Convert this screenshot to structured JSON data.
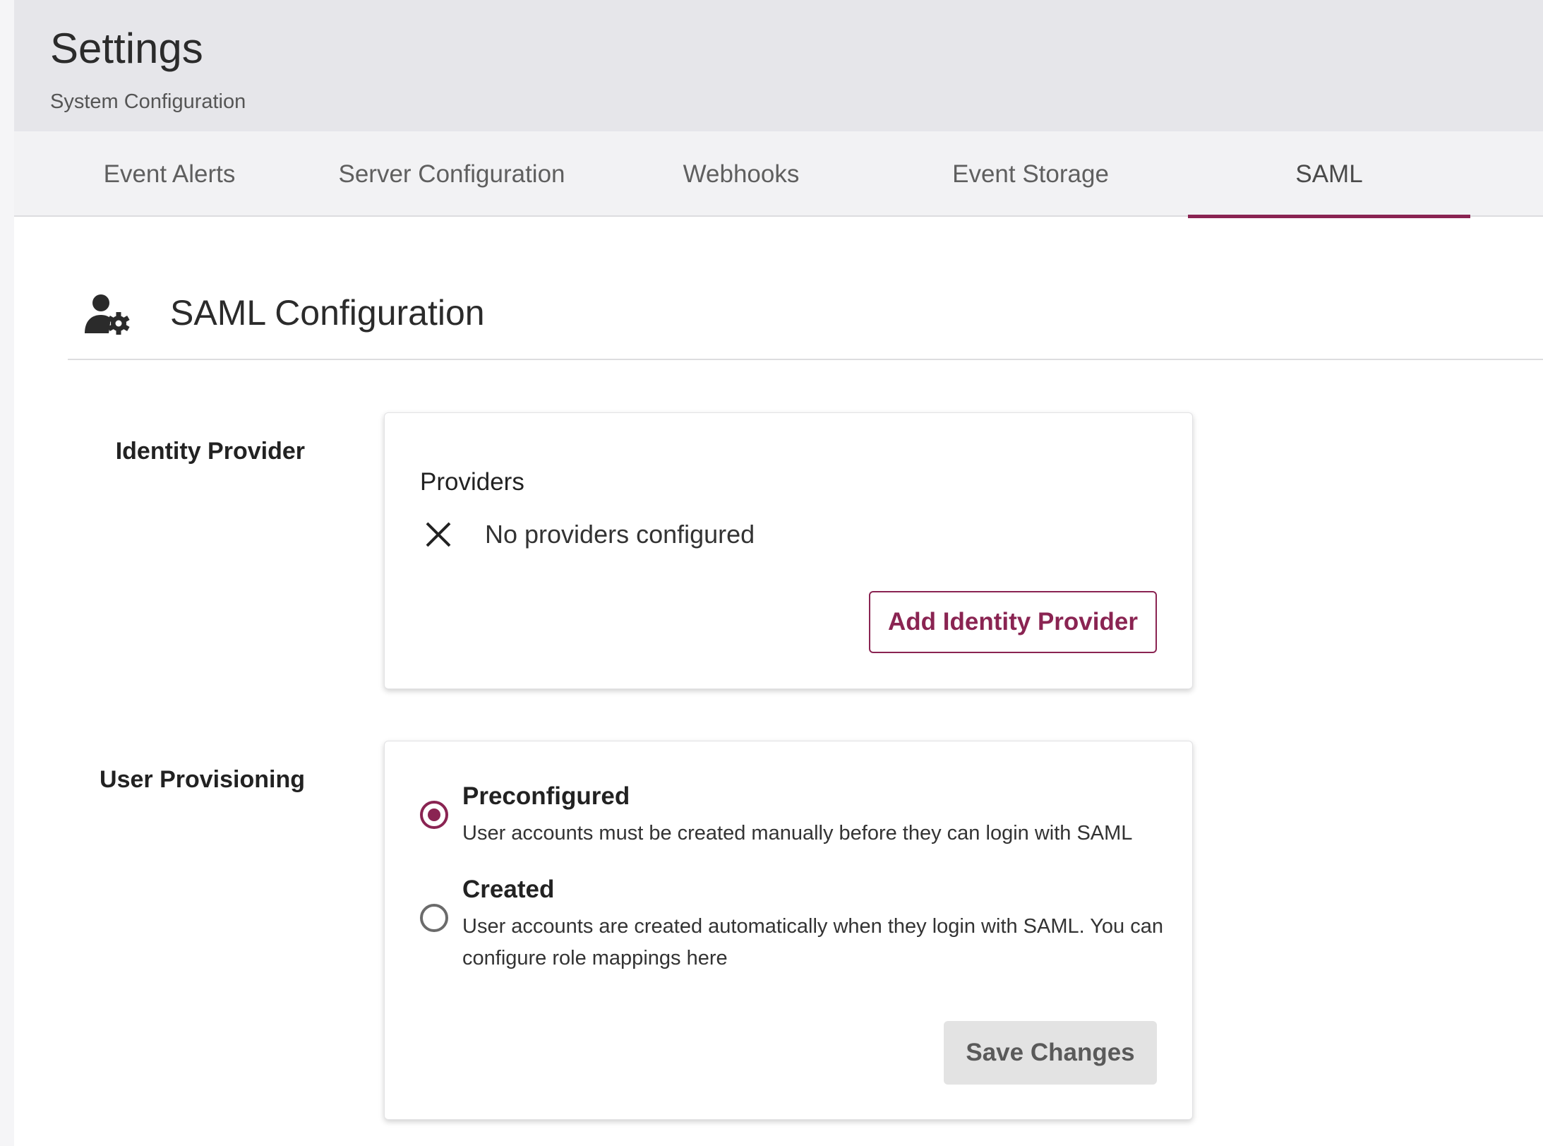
{
  "header": {
    "title": "Settings",
    "subtitle": "System Configuration"
  },
  "tabs": [
    {
      "label": "Event Alerts",
      "active": false
    },
    {
      "label": "Server Configuration",
      "active": false
    },
    {
      "label": "Webhooks",
      "active": false
    },
    {
      "label": "Event Storage",
      "active": false
    },
    {
      "label": "SAML",
      "active": true
    }
  ],
  "section": {
    "icon": "user-gear-icon",
    "title": "SAML Configuration"
  },
  "identity_provider": {
    "label": "Identity Provider",
    "providers_title": "Providers",
    "empty_icon": "close-icon",
    "empty_message": "No providers configured",
    "add_button": "Add Identity Provider"
  },
  "user_provisioning": {
    "label": "User Provisioning",
    "options": [
      {
        "title": "Preconfigured",
        "description": "User accounts must be created manually before they can login with SAML",
        "selected": true
      },
      {
        "title": "Created",
        "description": "User accounts are created automatically when they login with SAML. You can configure role mappings here",
        "selected": false
      }
    ],
    "save_button": "Save Changes"
  },
  "colors": {
    "accent": "#8a2452",
    "header_bg": "#e6e6ea",
    "tabs_bg": "#f2f2f4",
    "disabled_button_bg": "#e3e3e3"
  }
}
